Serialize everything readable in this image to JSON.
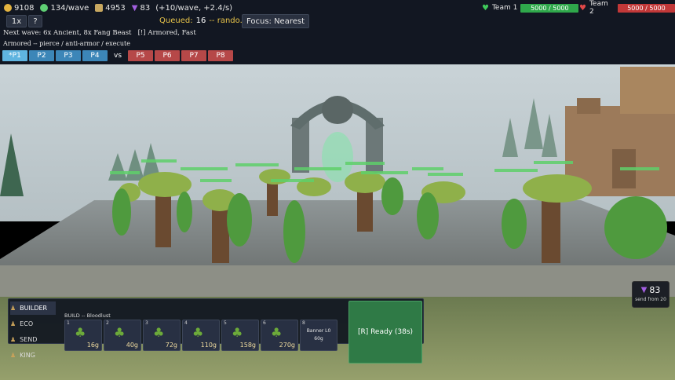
{
  "resources": {
    "gold": "9108",
    "income": "134/wave",
    "shield_value": "4953",
    "gems": "83",
    "gem_rate": "(+10/wave, +2.4/s)"
  },
  "speed_button": "1x",
  "help_button": "?",
  "queue": {
    "label": "Queued:",
    "count": "16",
    "rest": "-- rando..."
  },
  "focus_button": "Focus: Nearest",
  "teams": {
    "team1": {
      "label": "Team 1",
      "hp": "5000 / 5000"
    },
    "team2": {
      "label": "Team 2",
      "hp": "5000 / 5000"
    }
  },
  "next_wave": "Next wave: 6x Ancient, 8x Fang Beast   [!] Armored, Fast",
  "armor_hint": "Armored -- pierce / anti-armor / execute",
  "players_left": [
    "*P1",
    "P2",
    "P3",
    "P4"
  ],
  "vs_label": "vs",
  "players_right": [
    "P5",
    "P6",
    "P7",
    "P8"
  ],
  "build_menu": {
    "nav": [
      "BUILDER",
      "ECO",
      "SEND",
      "KING"
    ],
    "header": "BUILD -- Bloodlust",
    "cards": [
      {
        "num": "1",
        "price": "16g"
      },
      {
        "num": "2",
        "price": "40g"
      },
      {
        "num": "3",
        "price": "72g"
      },
      {
        "num": "4",
        "price": "110g"
      },
      {
        "num": "5",
        "price": "158g"
      },
      {
        "num": "6",
        "price": "270g"
      },
      {
        "num": "8",
        "title": "Banner L0",
        "price": "60g"
      }
    ]
  },
  "ready_button": "[R] Ready (38s)",
  "send_panel": {
    "value": "83",
    "label": "send from 20"
  },
  "colors": {
    "team1": "#2fa84b",
    "team2": "#c23838",
    "ally": "#3c86b8",
    "enemy": "#b64848",
    "ready": "#2f7a46",
    "gem": "#a25fe0"
  }
}
